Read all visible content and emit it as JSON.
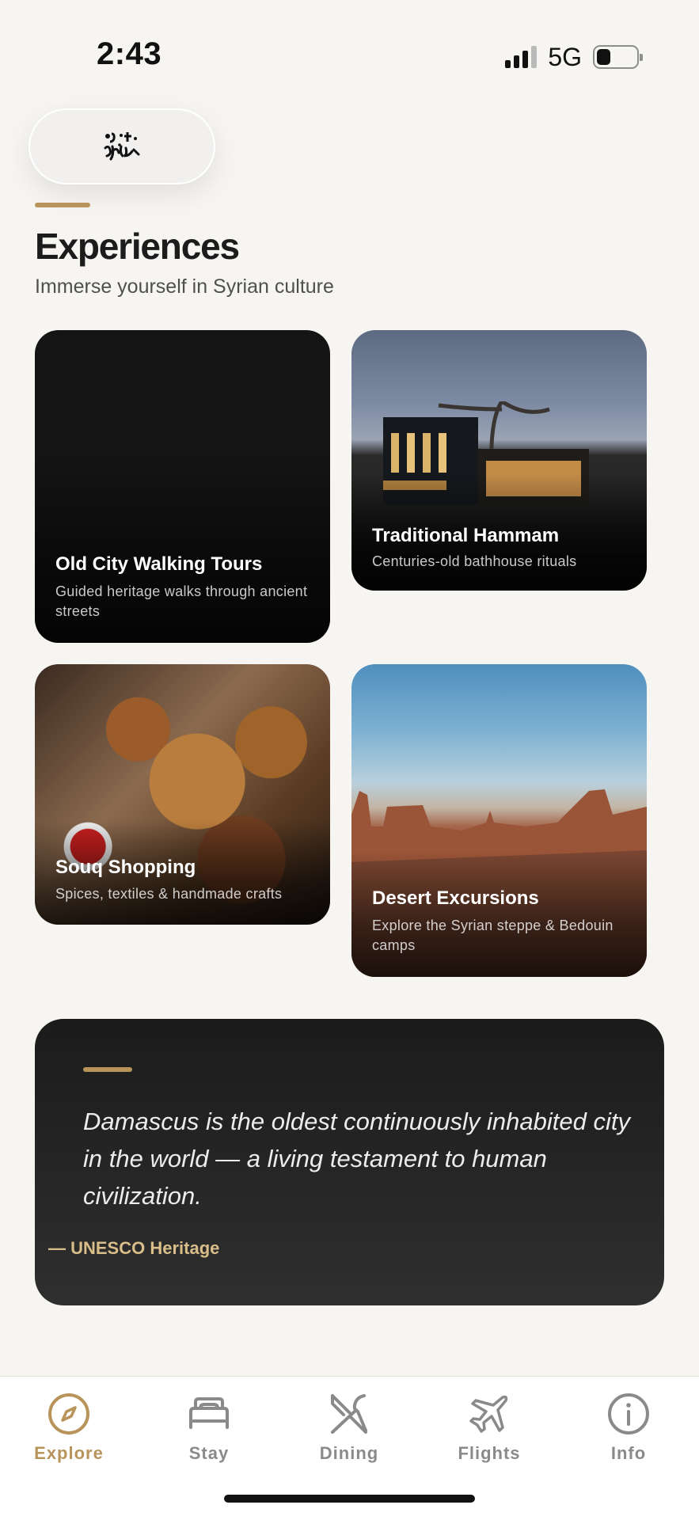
{
  "status_bar": {
    "time": "2:43",
    "network": "5G"
  },
  "logo": {
    "text": "ɔ̈·ẗ\nsyria"
  },
  "header": {
    "title": "Experiences",
    "subtitle": "Immerse yourself in Syrian culture"
  },
  "experiences": [
    {
      "title": "Old City Walking Tours",
      "description": "Guided heritage walks through ancient streets"
    },
    {
      "title": "Traditional Hammam",
      "description": "Centuries-old bathhouse rituals"
    },
    {
      "title": "Souq Shopping",
      "description": "Spices, textiles & handmade crafts"
    },
    {
      "title": "Desert Excursions",
      "description": "Explore the Syrian steppe & Bedouin camps"
    }
  ],
  "quote": {
    "text": "Damascus is the oldest continuously inhabited city in the world — a living testament to human civilization.",
    "source": "— UNESCO Heritage"
  },
  "tabs": [
    {
      "label": "Explore",
      "icon": "compass-icon",
      "active": true
    },
    {
      "label": "Stay",
      "icon": "bed-icon",
      "active": false
    },
    {
      "label": "Dining",
      "icon": "utensils-icon",
      "active": false
    },
    {
      "label": "Flights",
      "icon": "plane-icon",
      "active": false
    },
    {
      "label": "Info",
      "icon": "info-icon",
      "active": false
    }
  ],
  "colors": {
    "accent": "#b8935a",
    "background": "#f7f5f1",
    "inactive_tab": "#8a8a8a",
    "quote_bg": "#262626"
  }
}
